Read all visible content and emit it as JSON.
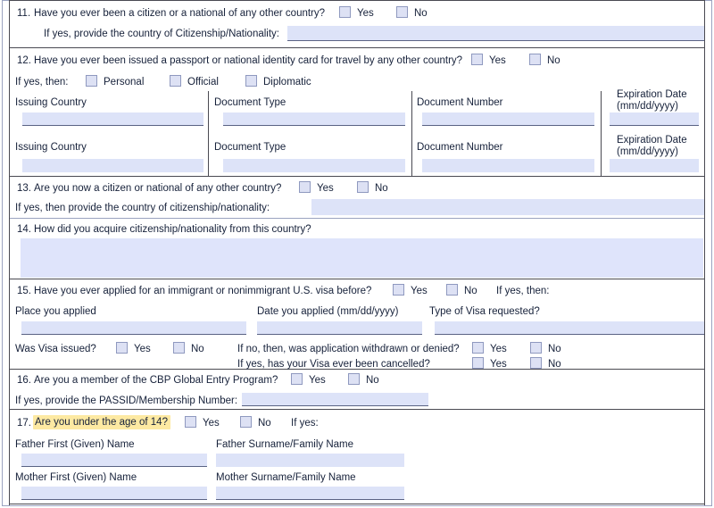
{
  "form": {
    "title": "DS-160 style immigrant visa form page (questions 11-17)",
    "field_placeholder": ""
  },
  "colors": {
    "field_fill": "#dde3f8",
    "checkbox_fill": "#dde1f4",
    "highlight": "#fde9a2",
    "rule": "#4a4a52",
    "text": "#16213a"
  },
  "common": {
    "yes": "Yes",
    "no": "No"
  },
  "q11": {
    "number": "11.",
    "question": "Have you ever been a citizen or a national of any other country?",
    "yes": "Yes",
    "no": "No",
    "subprompt": "If yes, provide the country of Citizenship/Nationality:",
    "country_value": ""
  },
  "q12": {
    "number": "12.",
    "question": "Have you ever been issued a passport or national identity card for travel by any other country?",
    "yes": "Yes",
    "no": "No",
    "ifyes": "If yes, then:",
    "options": [
      {
        "label": "Personal"
      },
      {
        "label": "Official"
      },
      {
        "label": "Diplomatic"
      }
    ],
    "columns": [
      "Issuing Country",
      "Document Type",
      "Document Number",
      "Expiration Date"
    ],
    "expiration_format": "(mm/dd/yyyy)",
    "rows": [
      {
        "issuing_country": "",
        "document_type": "",
        "document_number": "",
        "expiration_date": ""
      },
      {
        "issuing_country": "",
        "document_type": "",
        "document_number": "",
        "expiration_date": ""
      }
    ]
  },
  "q13": {
    "number": "13.",
    "question": "Are you now a citizen or national of any other country?",
    "yes": "Yes",
    "no": "No",
    "subprompt": "If yes, then provide the country of citizenship/nationality:",
    "country_value": ""
  },
  "q14": {
    "number": "14.",
    "question": "How did you acquire citizenship/nationality from this country?",
    "answer_value": ""
  },
  "q15": {
    "number": "15.",
    "question": "Have you ever applied for an immigrant or nonimmigrant U.S. visa before?",
    "yes": "Yes",
    "no": "No",
    "ifyes": "If yes, then:",
    "labels": {
      "place": "Place you applied",
      "date": "Date you applied (mm/dd/yyyy)",
      "type": "Type of Visa requested?"
    },
    "values": {
      "place": "",
      "date": "",
      "type": ""
    },
    "issued_label": "Was Visa issued?",
    "issued_yes": "Yes",
    "issued_no": "No",
    "withdrawn_label": "If no, then, was application withdrawn or denied?",
    "withdrawn_yes": "Yes",
    "withdrawn_no": "No",
    "cancelled_label": "If yes, has your Visa ever been cancelled?",
    "cancelled_yes": "Yes",
    "cancelled_no": "No"
  },
  "q16": {
    "number": "16.",
    "question": "Are you a member of the CBP Global Entry Program?",
    "yes": "Yes",
    "no": "No",
    "subprompt": "If yes, provide the PASSID/Membership Number:",
    "passid_value": ""
  },
  "q17": {
    "number": "17.",
    "question": "Are you under the age of 14?",
    "yes": "Yes",
    "no": "No",
    "ifyes": "If yes:",
    "labels": {
      "father_first": "Father First (Given) Name",
      "father_last": "Father Surname/Family Name",
      "mother_first": "Mother First (Given) Name",
      "mother_last": "Mother Surname/Family Name"
    },
    "values": {
      "father_first": "",
      "father_last": "",
      "mother_first": "",
      "mother_last": ""
    }
  }
}
